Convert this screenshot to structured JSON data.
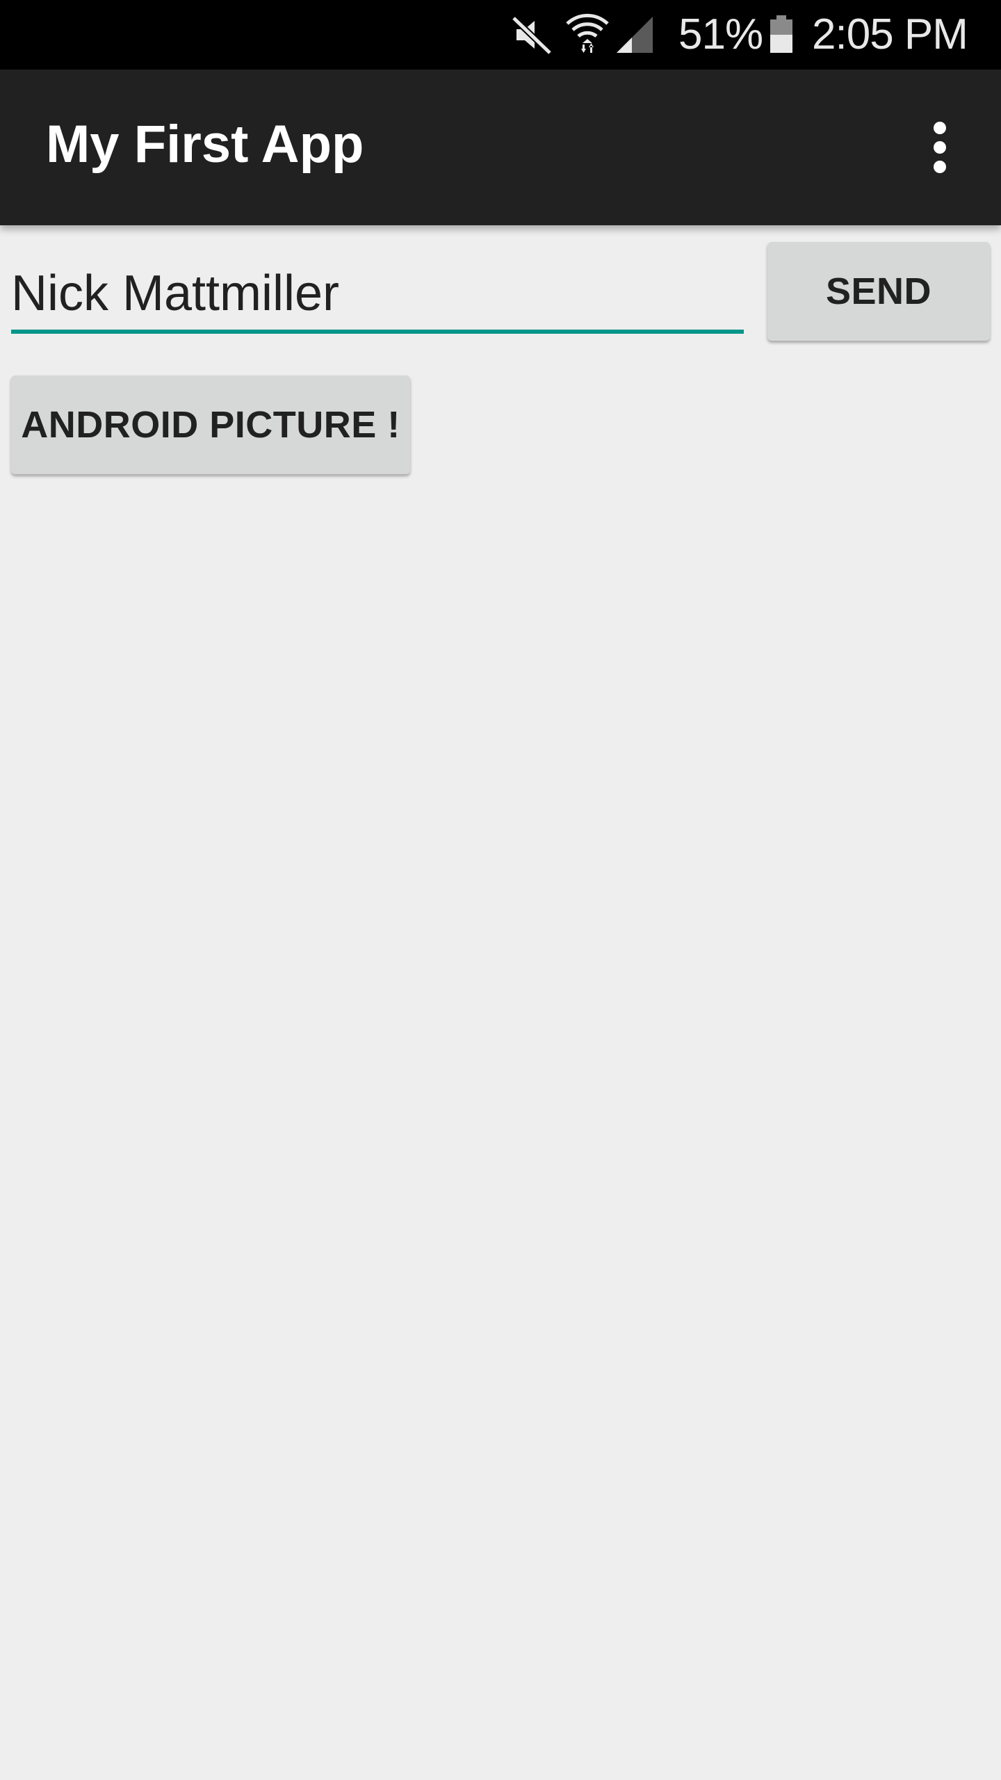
{
  "status_bar": {
    "battery_percent": "51%",
    "time": "2:05 PM",
    "icons": [
      "mute-icon",
      "wifi-icon",
      "signal-icon",
      "battery-icon"
    ]
  },
  "toolbar": {
    "title": "My First App",
    "overflow_icon": "more-vert-icon"
  },
  "main": {
    "message_field": {
      "value": "Nick Mattmiller"
    },
    "send_label": "SEND",
    "android_picture_label": "ANDROID PICTURE !"
  },
  "colors": {
    "status_bar": "#000000",
    "toolbar": "#212121",
    "background": "#eeeeee",
    "accent": "#009688",
    "button": "#d6d7d7"
  }
}
